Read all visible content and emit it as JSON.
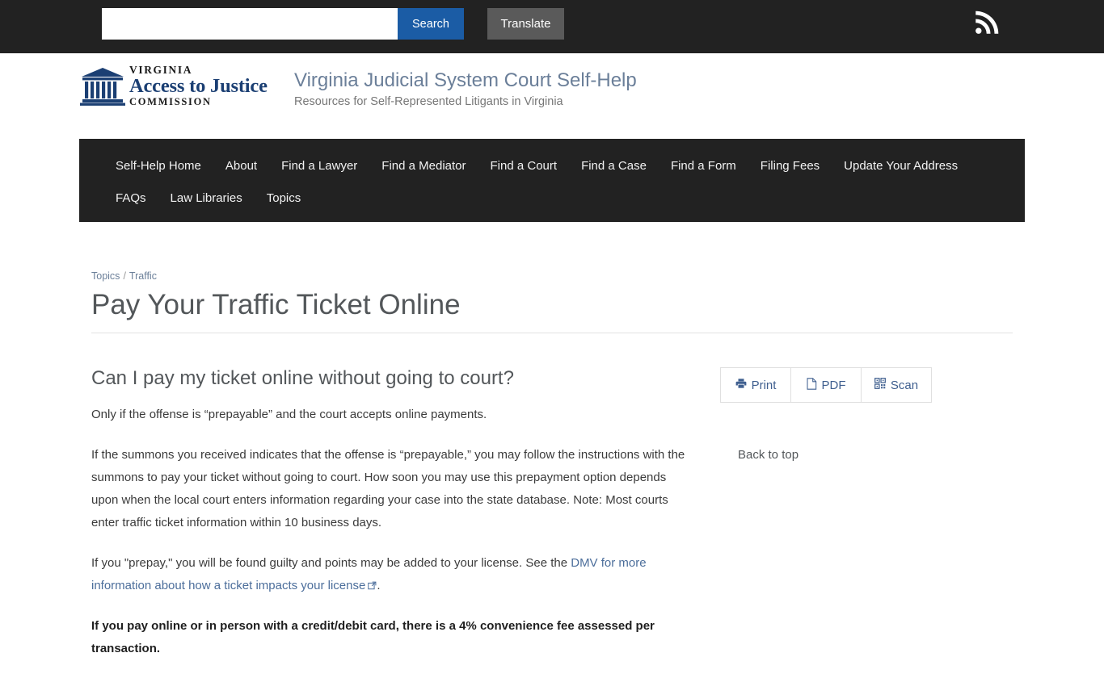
{
  "topbar": {
    "search_value": "",
    "search_placeholder": "",
    "search_button_label": "Search",
    "translate_button_label": "Translate",
    "rss_icon": "rss-feed-icon",
    "background_color": "#222222",
    "search_button_color": "#1b5ca5",
    "translate_button_color": "#5a5a5a"
  },
  "masthead": {
    "logo": {
      "icon": "courthouse-building-icon",
      "line1": "VIRGINIA",
      "line2": "Access to Justice",
      "line3": "COMMISSION",
      "color": "#1b3f73"
    },
    "site_title": "Virginia Judicial System Court Self-Help",
    "site_subtitle": "Resources for Self-Represented Litigants in Virginia"
  },
  "nav": {
    "items": [
      {
        "label": "Self-Help Home"
      },
      {
        "label": "About"
      },
      {
        "label": "Find a Lawyer"
      },
      {
        "label": "Find a Mediator"
      },
      {
        "label": "Find a Court"
      },
      {
        "label": "Find a Case"
      },
      {
        "label": "Find a Form"
      },
      {
        "label": "Filing Fees"
      },
      {
        "label": "Update Your Address"
      },
      {
        "label": "FAQs"
      },
      {
        "label": "Law Libraries"
      },
      {
        "label": "Topics"
      }
    ]
  },
  "breadcrumb": {
    "items": [
      {
        "label": "Topics"
      },
      {
        "label": "Traffic"
      }
    ],
    "separator": "/"
  },
  "main": {
    "page_title": "Pay Your Traffic Ticket Online",
    "section_heading": "Can I pay my ticket online without going to court?",
    "paragraph_1": "Only if the offense is “prepayable” and the court accepts online payments.",
    "paragraph_2": "If the summons you received indicates that the offense is “prepayable,” you may follow the instructions with the summons to pay your ticket without going to court.  How soon you may use this prepayment option depends upon when the local court enters information regarding your case into the state database.  Note: Most courts enter traffic ticket information within 10 business days.",
    "paragraph_3_pre": "If you \"prepay,\" you will be found guilty and points may be added to your license. See the ",
    "paragraph_3_link": "DMV for more information about how a ticket impacts your license",
    "paragraph_3_post": ".",
    "paragraph_4": "If you pay online or in person with a credit/debit card, there is a 4% convenience fee assessed per transaction."
  },
  "sidebar": {
    "tools": [
      {
        "label": "Print",
        "icon": "printer-icon"
      },
      {
        "label": "PDF",
        "icon": "document-icon"
      },
      {
        "label": "Scan",
        "icon": "qr-code-icon"
      }
    ],
    "back_to_top_label": "Back to top",
    "link_color": "#3f5f8f"
  }
}
